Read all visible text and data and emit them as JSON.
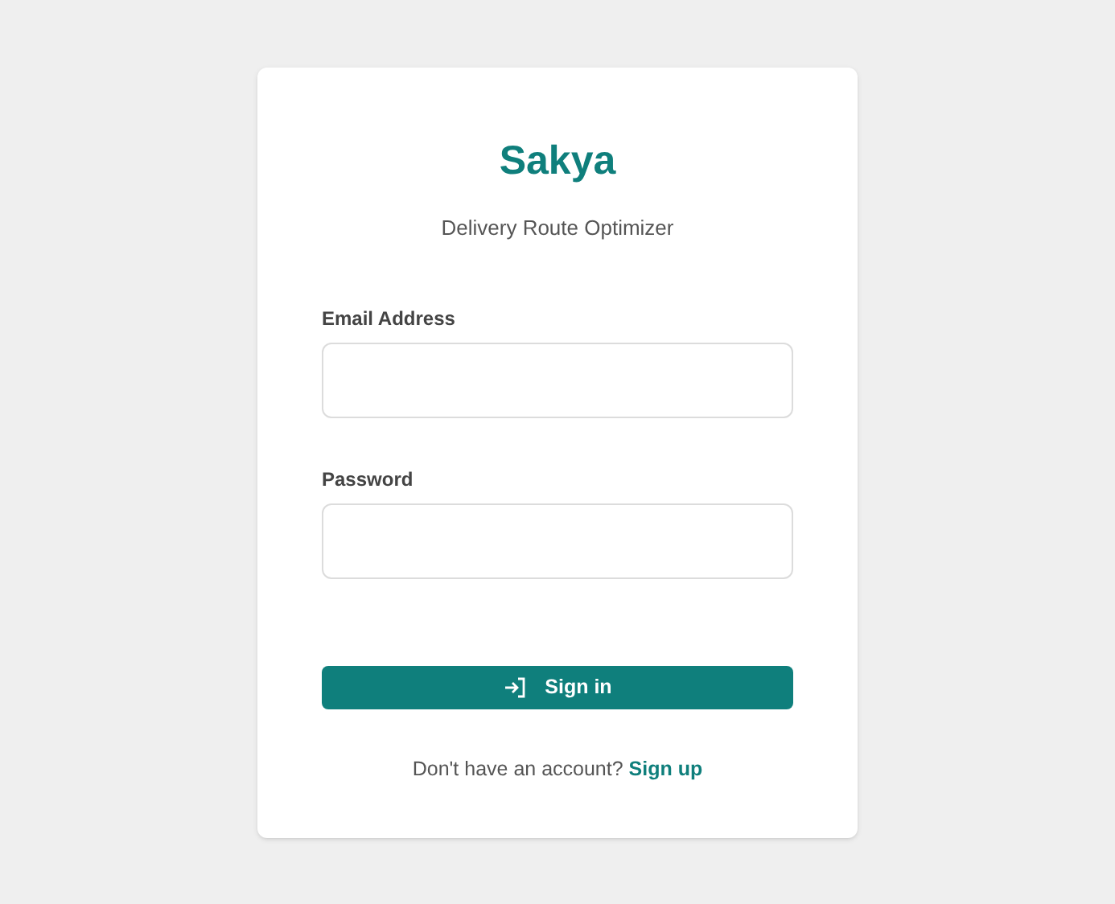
{
  "brand": {
    "title": "Sakya",
    "subtitle": "Delivery Route Optimizer"
  },
  "fields": [
    {
      "label": "Email Address"
    },
    {
      "label": "Password"
    }
  ],
  "submit": {
    "label": "Sign in"
  },
  "footer": {
    "text": "Don't have an account?",
    "link": "Sign up"
  }
}
